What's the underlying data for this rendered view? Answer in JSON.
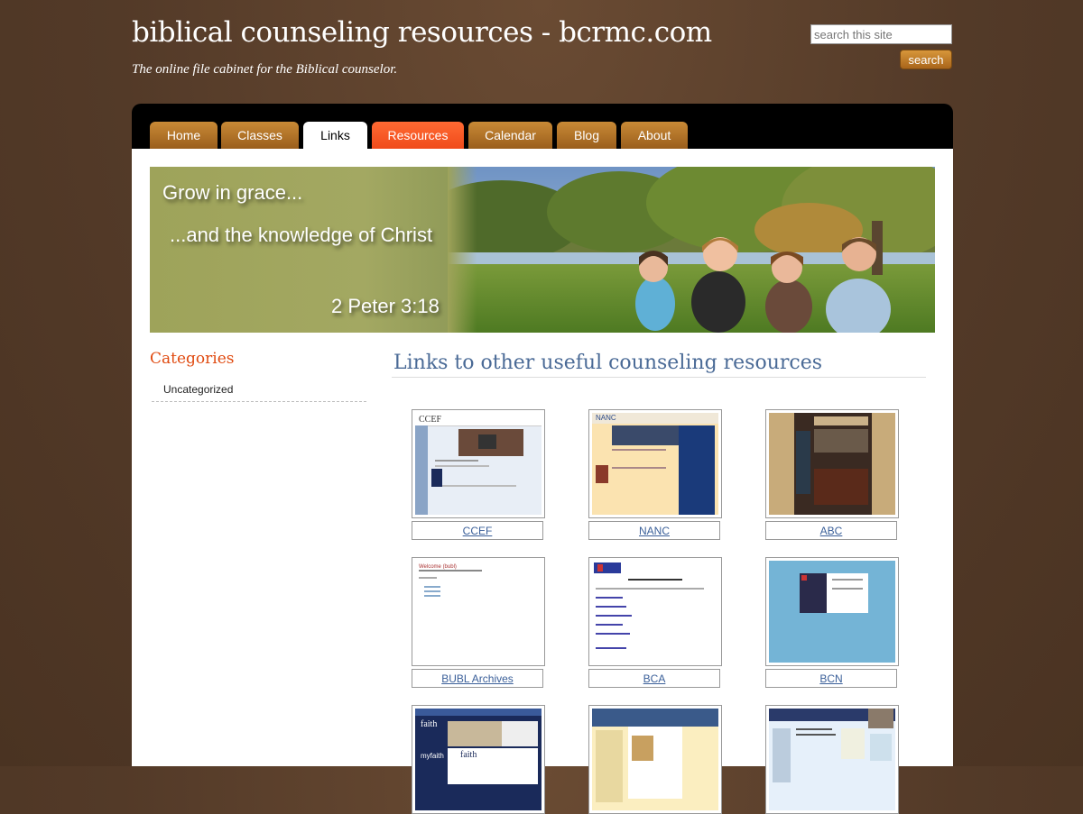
{
  "header": {
    "site_title": "biblical counseling resources - bcrmc.com",
    "tagline": "The online file cabinet for the Biblical counselor."
  },
  "search": {
    "placeholder": "search this site",
    "button_label": "search"
  },
  "nav": {
    "tabs": [
      {
        "label": "Home",
        "state": "normal"
      },
      {
        "label": "Classes",
        "state": "normal"
      },
      {
        "label": "Links",
        "state": "active"
      },
      {
        "label": "Resources",
        "state": "highlight"
      },
      {
        "label": "Calendar",
        "state": "normal"
      },
      {
        "label": "Blog",
        "state": "normal"
      },
      {
        "label": "About",
        "state": "normal"
      }
    ]
  },
  "banner": {
    "line1": "Grow in grace...",
    "line2": "...and the knowledge of Christ",
    "reference": "2 Peter 3:18"
  },
  "sidebar": {
    "heading": "Categories",
    "items": [
      "Uncategorized"
    ]
  },
  "main": {
    "title": "Links to other useful counseling resources",
    "links": [
      {
        "label": "CCEF"
      },
      {
        "label": "NANC"
      },
      {
        "label": "ABC"
      },
      {
        "label": "BUBL Archives"
      },
      {
        "label": "BCA"
      },
      {
        "label": "BCN"
      },
      {
        "label": ""
      },
      {
        "label": ""
      },
      {
        "label": ""
      }
    ]
  },
  "colors": {
    "background": "#533a28",
    "tab": "#b8782b",
    "tab_highlight": "#ff5a2a",
    "categories_heading": "#e04a10",
    "page_title": "#4a6a96",
    "link": "#3a5f99"
  }
}
